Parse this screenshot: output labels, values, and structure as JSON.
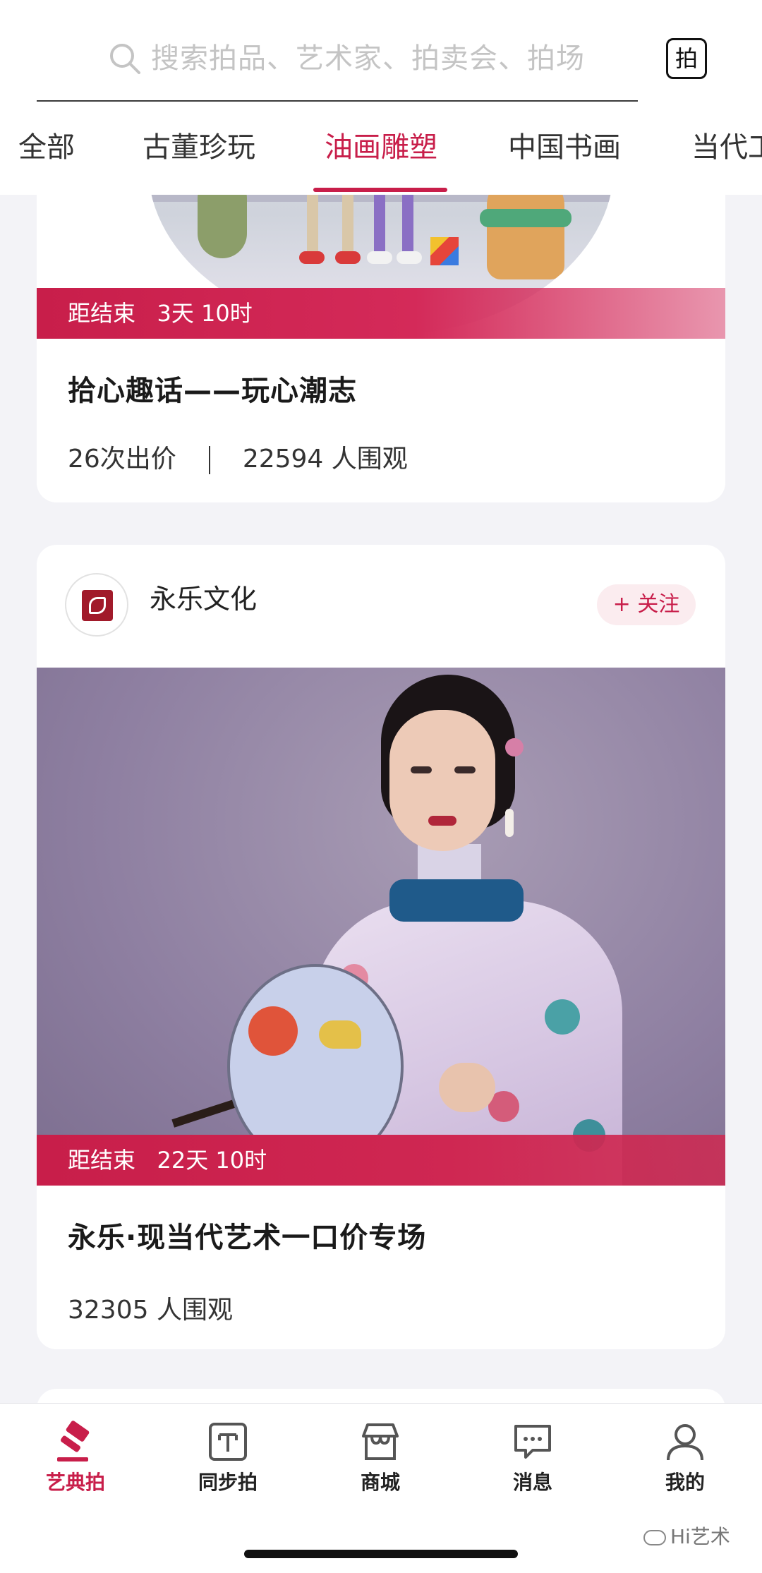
{
  "search": {
    "placeholder": "搜索拍品、艺术家、拍卖会、拍场",
    "action_label": "拍"
  },
  "tabs": [
    {
      "label": "全部"
    },
    {
      "label": "古董珍玩"
    },
    {
      "label": "油画雕塑",
      "active": true
    },
    {
      "label": "中国书画"
    },
    {
      "label": "当代工"
    }
  ],
  "auctions": [
    {
      "countdown": "距结束   3天 10时",
      "title": "拾心趣话——玩心潮志",
      "bids": "26次出价",
      "views": "22594 人围观"
    },
    {
      "seller": {
        "name": "永乐文化",
        "follow_label": "+ 关注"
      },
      "countdown": "距结束   22天 10时",
      "title": "永乐·现当代艺术一口价专场",
      "views": "32305 人围观"
    }
  ],
  "bottom_nav": [
    {
      "label": "艺典拍",
      "icon": "gavel-icon",
      "active": true
    },
    {
      "label": "同步拍",
      "icon": "sync-auction-icon"
    },
    {
      "label": "商城",
      "icon": "store-icon"
    },
    {
      "label": "消息",
      "icon": "message-icon"
    },
    {
      "label": "我的",
      "icon": "profile-icon"
    }
  ],
  "watermark": "Hi艺术",
  "colors": {
    "accent": "#c81e4a",
    "background": "#f3f3f7"
  }
}
